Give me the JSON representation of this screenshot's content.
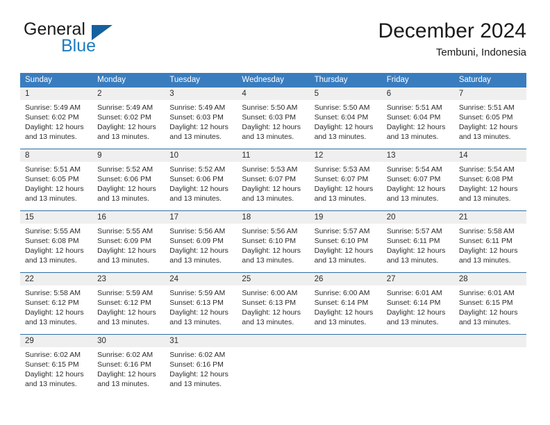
{
  "brand": {
    "name_part1": "General",
    "name_part2": "Blue",
    "logo_icon": "blue-triangle-icon"
  },
  "header": {
    "title": "December 2024",
    "location": "Tembuni, Indonesia"
  },
  "colors": {
    "header_blue": "#3a7dbf",
    "row_divider_blue": "#2e6da4",
    "day_strip_gray": "#efefef",
    "brand_blue": "#1f7bc1",
    "brand_triangle": "#15619e",
    "text": "#2b2b2b"
  },
  "weekdays": [
    "Sunday",
    "Monday",
    "Tuesday",
    "Wednesday",
    "Thursday",
    "Friday",
    "Saturday"
  ],
  "weeks": [
    [
      {
        "day": "1",
        "sunrise": "Sunrise: 5:49 AM",
        "sunset": "Sunset: 6:02 PM",
        "daylight1": "Daylight: 12 hours",
        "daylight2": "and 13 minutes."
      },
      {
        "day": "2",
        "sunrise": "Sunrise: 5:49 AM",
        "sunset": "Sunset: 6:02 PM",
        "daylight1": "Daylight: 12 hours",
        "daylight2": "and 13 minutes."
      },
      {
        "day": "3",
        "sunrise": "Sunrise: 5:49 AM",
        "sunset": "Sunset: 6:03 PM",
        "daylight1": "Daylight: 12 hours",
        "daylight2": "and 13 minutes."
      },
      {
        "day": "4",
        "sunrise": "Sunrise: 5:50 AM",
        "sunset": "Sunset: 6:03 PM",
        "daylight1": "Daylight: 12 hours",
        "daylight2": "and 13 minutes."
      },
      {
        "day": "5",
        "sunrise": "Sunrise: 5:50 AM",
        "sunset": "Sunset: 6:04 PM",
        "daylight1": "Daylight: 12 hours",
        "daylight2": "and 13 minutes."
      },
      {
        "day": "6",
        "sunrise": "Sunrise: 5:51 AM",
        "sunset": "Sunset: 6:04 PM",
        "daylight1": "Daylight: 12 hours",
        "daylight2": "and 13 minutes."
      },
      {
        "day": "7",
        "sunrise": "Sunrise: 5:51 AM",
        "sunset": "Sunset: 6:05 PM",
        "daylight1": "Daylight: 12 hours",
        "daylight2": "and 13 minutes."
      }
    ],
    [
      {
        "day": "8",
        "sunrise": "Sunrise: 5:51 AM",
        "sunset": "Sunset: 6:05 PM",
        "daylight1": "Daylight: 12 hours",
        "daylight2": "and 13 minutes."
      },
      {
        "day": "9",
        "sunrise": "Sunrise: 5:52 AM",
        "sunset": "Sunset: 6:06 PM",
        "daylight1": "Daylight: 12 hours",
        "daylight2": "and 13 minutes."
      },
      {
        "day": "10",
        "sunrise": "Sunrise: 5:52 AM",
        "sunset": "Sunset: 6:06 PM",
        "daylight1": "Daylight: 12 hours",
        "daylight2": "and 13 minutes."
      },
      {
        "day": "11",
        "sunrise": "Sunrise: 5:53 AM",
        "sunset": "Sunset: 6:07 PM",
        "daylight1": "Daylight: 12 hours",
        "daylight2": "and 13 minutes."
      },
      {
        "day": "12",
        "sunrise": "Sunrise: 5:53 AM",
        "sunset": "Sunset: 6:07 PM",
        "daylight1": "Daylight: 12 hours",
        "daylight2": "and 13 minutes."
      },
      {
        "day": "13",
        "sunrise": "Sunrise: 5:54 AM",
        "sunset": "Sunset: 6:07 PM",
        "daylight1": "Daylight: 12 hours",
        "daylight2": "and 13 minutes."
      },
      {
        "day": "14",
        "sunrise": "Sunrise: 5:54 AM",
        "sunset": "Sunset: 6:08 PM",
        "daylight1": "Daylight: 12 hours",
        "daylight2": "and 13 minutes."
      }
    ],
    [
      {
        "day": "15",
        "sunrise": "Sunrise: 5:55 AM",
        "sunset": "Sunset: 6:08 PM",
        "daylight1": "Daylight: 12 hours",
        "daylight2": "and 13 minutes."
      },
      {
        "day": "16",
        "sunrise": "Sunrise: 5:55 AM",
        "sunset": "Sunset: 6:09 PM",
        "daylight1": "Daylight: 12 hours",
        "daylight2": "and 13 minutes."
      },
      {
        "day": "17",
        "sunrise": "Sunrise: 5:56 AM",
        "sunset": "Sunset: 6:09 PM",
        "daylight1": "Daylight: 12 hours",
        "daylight2": "and 13 minutes."
      },
      {
        "day": "18",
        "sunrise": "Sunrise: 5:56 AM",
        "sunset": "Sunset: 6:10 PM",
        "daylight1": "Daylight: 12 hours",
        "daylight2": "and 13 minutes."
      },
      {
        "day": "19",
        "sunrise": "Sunrise: 5:57 AM",
        "sunset": "Sunset: 6:10 PM",
        "daylight1": "Daylight: 12 hours",
        "daylight2": "and 13 minutes."
      },
      {
        "day": "20",
        "sunrise": "Sunrise: 5:57 AM",
        "sunset": "Sunset: 6:11 PM",
        "daylight1": "Daylight: 12 hours",
        "daylight2": "and 13 minutes."
      },
      {
        "day": "21",
        "sunrise": "Sunrise: 5:58 AM",
        "sunset": "Sunset: 6:11 PM",
        "daylight1": "Daylight: 12 hours",
        "daylight2": "and 13 minutes."
      }
    ],
    [
      {
        "day": "22",
        "sunrise": "Sunrise: 5:58 AM",
        "sunset": "Sunset: 6:12 PM",
        "daylight1": "Daylight: 12 hours",
        "daylight2": "and 13 minutes."
      },
      {
        "day": "23",
        "sunrise": "Sunrise: 5:59 AM",
        "sunset": "Sunset: 6:12 PM",
        "daylight1": "Daylight: 12 hours",
        "daylight2": "and 13 minutes."
      },
      {
        "day": "24",
        "sunrise": "Sunrise: 5:59 AM",
        "sunset": "Sunset: 6:13 PM",
        "daylight1": "Daylight: 12 hours",
        "daylight2": "and 13 minutes."
      },
      {
        "day": "25",
        "sunrise": "Sunrise: 6:00 AM",
        "sunset": "Sunset: 6:13 PM",
        "daylight1": "Daylight: 12 hours",
        "daylight2": "and 13 minutes."
      },
      {
        "day": "26",
        "sunrise": "Sunrise: 6:00 AM",
        "sunset": "Sunset: 6:14 PM",
        "daylight1": "Daylight: 12 hours",
        "daylight2": "and 13 minutes."
      },
      {
        "day": "27",
        "sunrise": "Sunrise: 6:01 AM",
        "sunset": "Sunset: 6:14 PM",
        "daylight1": "Daylight: 12 hours",
        "daylight2": "and 13 minutes."
      },
      {
        "day": "28",
        "sunrise": "Sunrise: 6:01 AM",
        "sunset": "Sunset: 6:15 PM",
        "daylight1": "Daylight: 12 hours",
        "daylight2": "and 13 minutes."
      }
    ],
    [
      {
        "day": "29",
        "sunrise": "Sunrise: 6:02 AM",
        "sunset": "Sunset: 6:15 PM",
        "daylight1": "Daylight: 12 hours",
        "daylight2": "and 13 minutes."
      },
      {
        "day": "30",
        "sunrise": "Sunrise: 6:02 AM",
        "sunset": "Sunset: 6:16 PM",
        "daylight1": "Daylight: 12 hours",
        "daylight2": "and 13 minutes."
      },
      {
        "day": "31",
        "sunrise": "Sunrise: 6:02 AM",
        "sunset": "Sunset: 6:16 PM",
        "daylight1": "Daylight: 12 hours",
        "daylight2": "and 13 minutes."
      },
      {
        "day": "",
        "sunrise": "",
        "sunset": "",
        "daylight1": "",
        "daylight2": ""
      },
      {
        "day": "",
        "sunrise": "",
        "sunset": "",
        "daylight1": "",
        "daylight2": ""
      },
      {
        "day": "",
        "sunrise": "",
        "sunset": "",
        "daylight1": "",
        "daylight2": ""
      },
      {
        "day": "",
        "sunrise": "",
        "sunset": "",
        "daylight1": "",
        "daylight2": ""
      }
    ]
  ]
}
